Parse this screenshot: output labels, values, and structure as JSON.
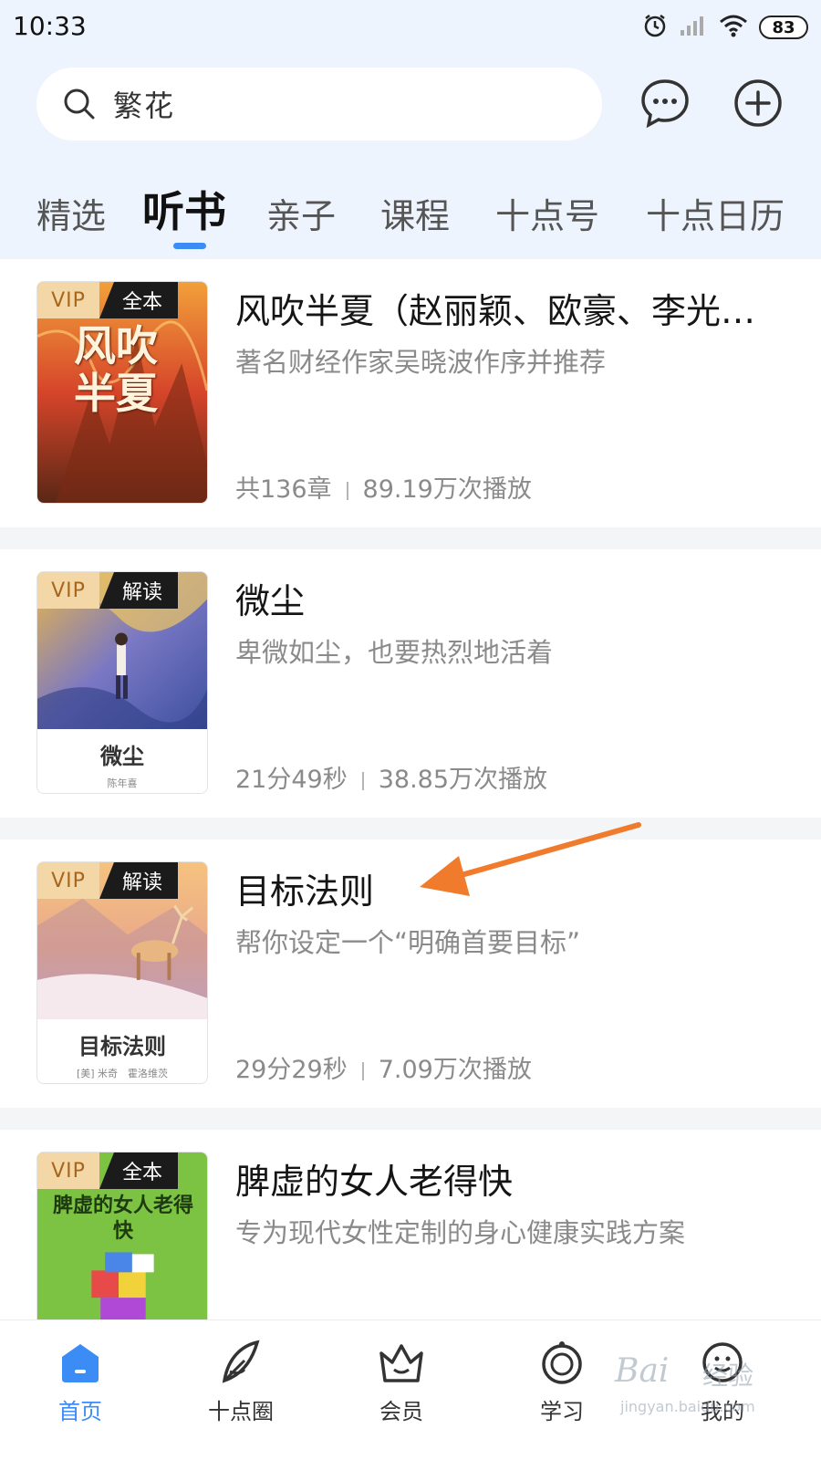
{
  "status_bar": {
    "time": "10:33",
    "battery": "83"
  },
  "search": {
    "query": "繁花"
  },
  "tabs": [
    {
      "label": "精选"
    },
    {
      "label": "听书"
    },
    {
      "label": "亲子"
    },
    {
      "label": "课程"
    },
    {
      "label": "十点号"
    },
    {
      "label": "十点日历"
    }
  ],
  "active_tab": "听书",
  "items": [
    {
      "title": "风吹半夏（赵丽颖、欧豪、李光洁...",
      "desc": "著名财经作家吴晓波作序并推荐",
      "badge_vip": "VIP",
      "badge_type": "全本",
      "meta_1": "共136章",
      "meta_2": "89.19万次播放",
      "cover_text": "风吹半夏"
    },
    {
      "title": "微尘",
      "desc": "卑微如尘，也要热烈地活着",
      "badge_vip": "VIP",
      "badge_type": "解读",
      "meta_1": "21分49秒",
      "meta_2": "38.85万次播放",
      "cover_title": "微尘",
      "cover_author": "陈年喜"
    },
    {
      "title": "目标法则",
      "desc": "帮你设定一个“明确首要目标”",
      "badge_vip": "VIP",
      "badge_type": "解读",
      "meta_1": "29分29秒",
      "meta_2": "7.09万次播放",
      "cover_title": "目标法则",
      "cover_author": "[美] 米奇　霍洛维茨"
    },
    {
      "title": "脾虚的女人老得快",
      "desc": "专为现代女性定制的身心健康实践方案",
      "badge_vip": "VIP",
      "badge_type": "全本",
      "cover_text": "脾虚的女人老得快"
    }
  ],
  "bottom_nav": [
    {
      "label": "首页",
      "icon": "home-icon",
      "active": true
    },
    {
      "label": "十点圈",
      "icon": "feather-icon"
    },
    {
      "label": "会员",
      "icon": "crown-icon"
    },
    {
      "label": "学习",
      "icon": "study-icon"
    },
    {
      "label": "我的",
      "icon": "profile-icon"
    }
  ],
  "watermark": {
    "logo": "Bai",
    "text": "经验",
    "url": "jingyan.baidu.com"
  },
  "colors": {
    "accent": "#3b8cf5",
    "header_bg": "#eef4fd",
    "arrow": "#f07b2c",
    "vip_bg": "#f3d7a6"
  }
}
